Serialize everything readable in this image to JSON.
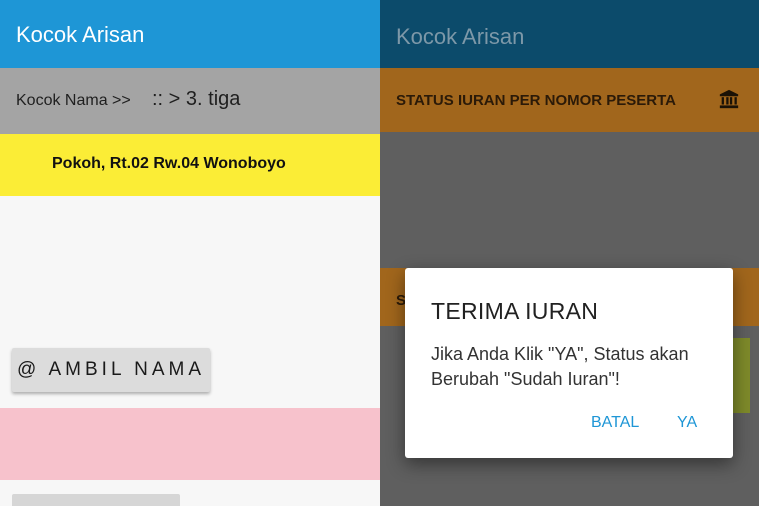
{
  "left_screen": {
    "app_title": "Kocok Arisan",
    "kocok_label": "Kocok Nama >>",
    "kocok_value": ":: > 3. tiga",
    "address": "Pokoh, Rt.02 Rw.04 Wonoboyo",
    "ambil_button": "@ AMBIL NAMA"
  },
  "right_screen": {
    "app_title": "Kocok Arisan",
    "status_header": "STATUS IURAN PER NOMOR PESERTA",
    "status_icon": "bank-icon",
    "partial_label": "S"
  },
  "dialog": {
    "title": "TERIMA IURAN",
    "message": "Jika Anda Klik \"YA\", Status akan Berubah \"Sudah Iuran\"!",
    "cancel_label": "BATAL",
    "confirm_label": "YA"
  },
  "colors": {
    "appbar": "#1e96d6",
    "address_bg": "#fbed36",
    "pink_bg": "#f7c2cc",
    "dialog_button": "#1e96d6"
  }
}
